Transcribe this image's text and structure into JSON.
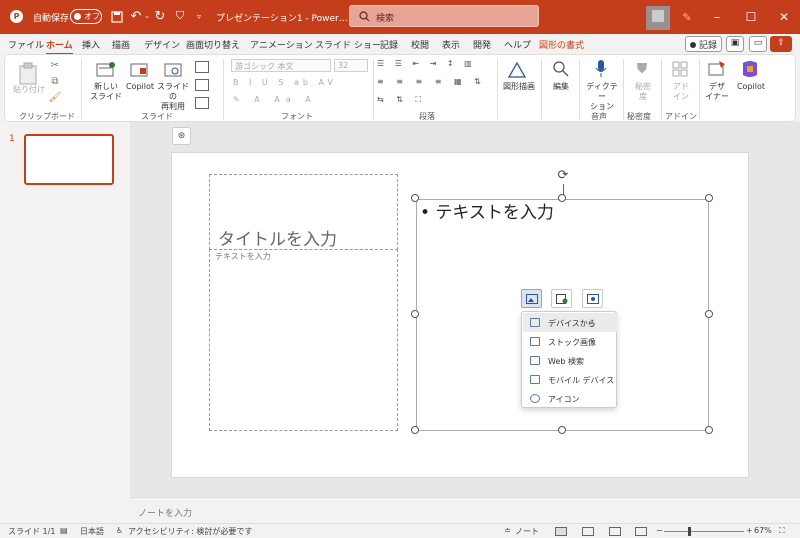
{
  "titlebar": {
    "autosave_label": "自動保存",
    "autosave_state": "オフ",
    "doc_title": "プレゼンテーション1 - Power…",
    "search_placeholder": "検索",
    "accent": "#c43e1c"
  },
  "menu": {
    "items": [
      "ファイル",
      "ホーム",
      "挿入",
      "描画",
      "デザイン",
      "画面切り替え",
      "アニメーション",
      "スライド ショー",
      "記録",
      "校閲",
      "表示",
      "開発",
      "ヘルプ",
      "図形の書式"
    ],
    "active": "ホーム",
    "record_label": "記録"
  },
  "ribbon": {
    "clipboard": {
      "paste": "貼り付け",
      "label": "クリップボード"
    },
    "slides": {
      "new_slide": "新しい\nスライド",
      "copilot": "Copilot",
      "reuse": "スライドの\n再利用",
      "label": "スライド"
    },
    "font": {
      "font_name": "游ゴシック 本文",
      "font_size": "32",
      "label": "フォント"
    },
    "paragraph": {
      "label": "段落"
    },
    "drawing": {
      "shapes": "図形描画"
    },
    "editing": {
      "find": "編集"
    },
    "voice": {
      "dictate": "ディクテー\nション",
      "label": "音声"
    },
    "sensitivity": {
      "btn": "秘密\n度",
      "label": "秘密度"
    },
    "addins": {
      "btn": "アド\nイン",
      "label": "アドイン"
    },
    "designer": {
      "btn": "デザ\nイナー"
    },
    "copilot2": {
      "btn": "Copilot"
    }
  },
  "thumbs": {
    "slide_number": "1"
  },
  "slide": {
    "title_placeholder": "タイトルを入力",
    "text_placeholder": "テキストを入力",
    "content_placeholder": "• テキストを入力"
  },
  "insert_dropdown": {
    "items": [
      "デバイスから",
      "ストック画像",
      "Web 検索",
      "モバイル デバイス",
      "アイコン"
    ]
  },
  "notes": {
    "placeholder": "ノートを入力"
  },
  "status": {
    "slide_count": "スライド 1/1",
    "language": "日本語",
    "accessibility": "アクセシビリティ: 検討が必要です",
    "notes_btn": "ノート",
    "zoom": "67%"
  }
}
